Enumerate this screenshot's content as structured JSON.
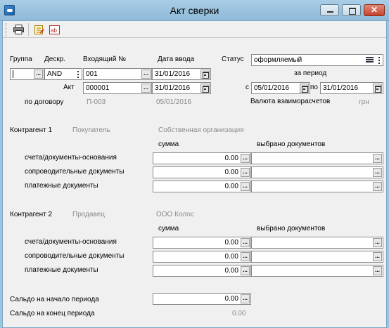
{
  "window": {
    "title": "Акт сверки"
  },
  "header": {
    "group_label": "Группа",
    "descr_label": "Дескр.",
    "incoming_label": "Входящий №",
    "date_label": "Дата ввода",
    "status_label": "Статус",
    "descr_value": "AND",
    "incoming_value": "001",
    "date_value": "31/01/2016",
    "status_value": "оформляемый",
    "period_label": "за период",
    "act_label": "Акт",
    "act_value": "000001",
    "act_date": "31/01/2016",
    "from_label": "с",
    "from_value": "05/01/2016",
    "to_label": "по",
    "to_value": "31/01/2016",
    "contract_label": "по договору",
    "contract_value": "П-003",
    "contract_date": "05/01/2016",
    "currency_label": "Валюта взаиморасчетов",
    "currency_value": "грн"
  },
  "counterparty1": {
    "title": "Контрагент 1",
    "role": "Покупатель",
    "org": "Собственная организация",
    "sum_header": "сумма",
    "selected_header": "выбрано документов",
    "rows": [
      {
        "label": "счета/документы-основания",
        "value": "0.00"
      },
      {
        "label": "сопроводительные документы",
        "value": "0.00"
      },
      {
        "label": "платежные документы",
        "value": "0.00"
      }
    ]
  },
  "counterparty2": {
    "title": "Контрагент 2",
    "role": "Продавец",
    "org": "ООО Колос",
    "sum_header": "сумма",
    "selected_header": "выбрано документов",
    "rows": [
      {
        "label": "счета/документы-основания",
        "value": "0.00"
      },
      {
        "label": "сопроводительные документы",
        "value": "0.00"
      },
      {
        "label": "платежные документы",
        "value": "0.00"
      }
    ]
  },
  "balance": {
    "start_label": "Сальдо на начало периода",
    "start_value": "0.00",
    "end_label": "Сальдо на конец периода",
    "end_value": "0.00"
  },
  "buttons": {
    "ellipsis": "..."
  }
}
